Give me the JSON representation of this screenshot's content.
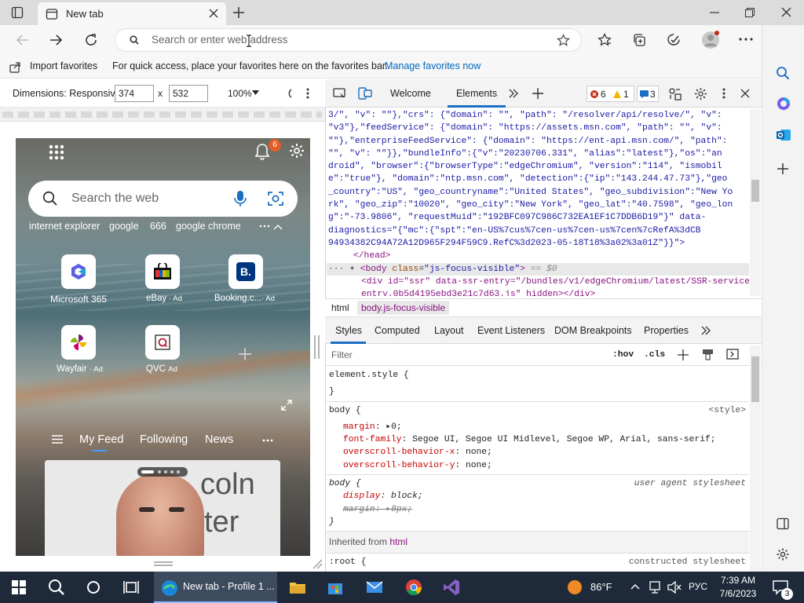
{
  "browser": {
    "tab_title": "New tab",
    "omnibox_placeholder": "Search or enter web address"
  },
  "favorites_bar": {
    "import_label": "Import favorites",
    "hint": "For quick access, place your favorites here on the favorites bar.",
    "manage_link": "Manage favorites now"
  },
  "device_toolbar": {
    "dimensions_label": "Dimensions: Responsive",
    "width": "374",
    "times": "x",
    "height": "532",
    "zoom": "100%"
  },
  "newtab": {
    "notification_count": "6",
    "search_placeholder": "Search the web",
    "quick_links": [
      "internet explorer",
      "google",
      "666",
      "google chrome"
    ],
    "tiles": [
      {
        "name": "Microsoft 365",
        "ad": ""
      },
      {
        "name": "eBay",
        "ad": "· Ad"
      },
      {
        "name": "Booking.c...",
        "ad": "· Ad"
      },
      {
        "name": "Wayfair",
        "ad": "· Ad"
      },
      {
        "name": "QVC",
        "ad": "· Ad"
      }
    ],
    "feed_tabs": [
      "My Feed",
      "Following",
      "News"
    ],
    "card_text_line1": "coln",
    "card_text_line2": "ter"
  },
  "devtools": {
    "tabs": [
      "Welcome",
      "Elements"
    ],
    "errors": "6",
    "warnings": "1",
    "messages": "3",
    "code_lines": [
      "3/\", \"v\": \"\"},\"crs\": {\"domain\": \"\", \"path\": \"/resolver/api/resolve/\", \"v\":",
      "\"v3\"},\"feedService\": {\"domain\": \"https://assets.msn.com\", \"path\": \"\", \"v\":",
      "\"\"},\"enterpriseFeedService\": {\"domain\": \"https://ent-api.msn.com/\", \"path\":",
      "\"\", \"v\": \"\"}},\"bundleInfo\":{\"v\":\"20230706.331\", \"alias\":\"latest\"},\"os\":\"an",
      "droid\", \"browser\":{\"browserType\":\"edgeChromium\", \"version\":\"114\", \"ismobil",
      "e\":\"true\"}, \"domain\":\"ntp.msn.com\", \"detection\":{\"ip\":\"143.244.47.73\"},\"geo",
      "_country\":\"US\", \"geo_countryname\":\"United States\", \"geo_subdivision\":\"New Yo",
      "rk\", \"geo_zip\":\"10020\", \"geo_city\":\"New York\", \"geo_lat\":\"40.7598\", \"geo_lon",
      "g\":\"-73.9806\", \"requestMuid\":\"192BFC097C986C732EA1EF1C7DDB6D19\"}\" data-",
      "diagnostics=\"{\"mc\":{\"spt\":\"en-US%7cus%7cen-us%7cen-us%7cen%7cRefA%3dCB",
      "94934382C94A72A12D965F294F59C9.RefC%3d2023-05-18T18%3a02%3a01Z\"}}\">"
    ],
    "head_close": "</head>",
    "body_open_tag": "body",
    "body_class_attr": "class",
    "body_class_value": "\"js-focus-visible\"",
    "body_suffix": "== $0",
    "div_line1": "<div id=\"ssr\" data-ssr-entry=\"/bundles/v1/edgeChromium/latest/SSR-service-",
    "div_line2": "entry.0b5d4195ebd3e21c7d63.js\" hidden></div>",
    "breadcrumbs": [
      "html",
      "body.js-focus-visible"
    ],
    "style_tabs": [
      "Styles",
      "Computed",
      "Layout",
      "Event Listeners",
      "DOM Breakpoints",
      "Properties"
    ],
    "filter_placeholder": "Filter",
    "hov": ":hov",
    "cls": ".cls",
    "rules": {
      "element_style": "element.style {",
      "close": "}",
      "body_selector": "body {",
      "body_source": "<style>",
      "margin": "margin",
      "margin_val": "0;",
      "font_family": "font-family",
      "font_family_val": "Segoe UI, Segoe UI Midlevel, Segoe WP, Arial, sans-serif;",
      "osx": "overscroll-behavior-x",
      "osx_val": "none;",
      "osy": "overscroll-behavior-y",
      "osy_val": "none;",
      "ua_selector": "body {",
      "ua_source": "user agent stylesheet",
      "display": "display",
      "display_val": "block;",
      "ua_margin": "margin",
      "ua_margin_val": "8px;",
      "inherited": "Inherited from",
      "inherited_el": "html",
      "root_selector": ":root {",
      "root_source": "constructed stylesheet"
    }
  },
  "taskbar": {
    "edge_task": "New tab - Profile 1 ...",
    "weather": "86°F",
    "lang": "РУС",
    "time": "7:39 AM",
    "date": "7/6/2023",
    "notifications": "3"
  }
}
